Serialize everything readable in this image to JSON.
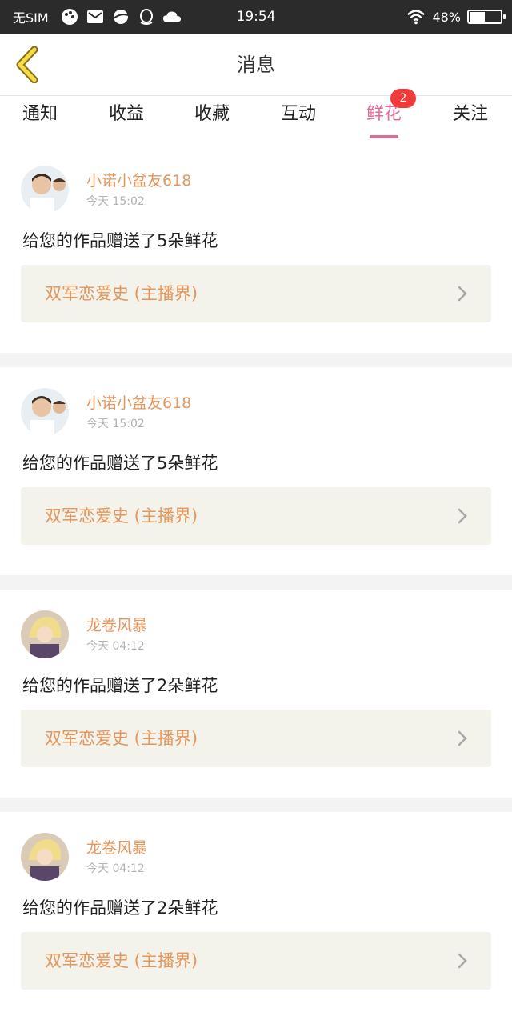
{
  "status_bar": {
    "carrier": "无SIM",
    "time": "19:54",
    "battery": "48%",
    "battery_level": 0.48,
    "icons": [
      "paint-icon",
      "mail-icon",
      "planet-icon",
      "qq-icon",
      "cloud-icon"
    ]
  },
  "header": {
    "title": "消息",
    "back_icon": "chevron-left-icon"
  },
  "tabs": [
    {
      "label": "通知"
    },
    {
      "label": "收益"
    },
    {
      "label": "收藏"
    },
    {
      "label": "互动"
    },
    {
      "label": "鲜花",
      "badge": "2",
      "active": true
    },
    {
      "label": "关注"
    }
  ],
  "messages": [
    {
      "sender": "小诺小盆友618",
      "time": "今天 15:02",
      "text": "给您的作品赠送了5朵鲜花",
      "work": "双军恋爱史 (主播界)"
    },
    {
      "sender": "小诺小盆友618",
      "time": "今天 15:02",
      "text": "给您的作品赠送了5朵鲜花",
      "work": "双军恋爱史 (主播界)"
    },
    {
      "sender": "龙卷风暴",
      "time": "今天 04:12",
      "text": "给您的作品赠送了2朵鲜花",
      "work": "双军恋爱史 (主播界)"
    },
    {
      "sender": "龙卷风暴",
      "time": "今天 04:12",
      "text": "给您的作品赠送了2朵鲜花",
      "work": "双军恋爱史 (主播界)"
    }
  ],
  "colors": {
    "accent_pink": "#e0699a",
    "name_orange": "#e6955b",
    "badge_red": "#f33a3a",
    "card_bg": "#f3f3eb"
  }
}
